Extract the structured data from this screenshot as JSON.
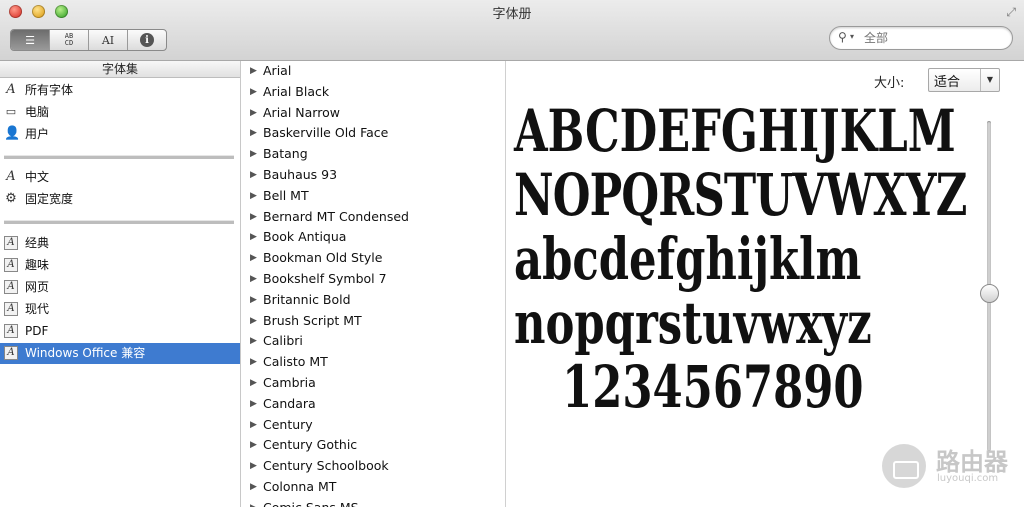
{
  "window": {
    "title": "字体册"
  },
  "toolbar": {
    "view_buttons": [
      {
        "name": "list-view",
        "glyph": "☰"
      },
      {
        "name": "sample-view",
        "glyph": "AB CD"
      },
      {
        "name": "custom-view",
        "glyph": "AI"
      },
      {
        "name": "info-view",
        "glyph": "i"
      }
    ],
    "search": {
      "placeholder": "全部"
    }
  },
  "collections": {
    "header": "字体集",
    "groups": [
      [
        {
          "label": "所有字体",
          "icon": "font-icon"
        },
        {
          "label": "电脑",
          "icon": "computer-icon"
        },
        {
          "label": "用户",
          "icon": "user-icon"
        }
      ],
      [
        {
          "label": "中文",
          "icon": "font-icon"
        },
        {
          "label": "固定宽度",
          "icon": "gear-icon"
        }
      ],
      [
        {
          "label": "经典",
          "icon": "collection-icon"
        },
        {
          "label": "趣味",
          "icon": "collection-icon"
        },
        {
          "label": "网页",
          "icon": "collection-icon"
        },
        {
          "label": "现代",
          "icon": "collection-icon"
        },
        {
          "label": "PDF",
          "icon": "collection-icon"
        },
        {
          "label": "Windows Office 兼容",
          "icon": "collection-icon",
          "selected": true
        }
      ]
    ]
  },
  "fonts": [
    "Arial",
    "Arial Black",
    "Arial Narrow",
    "Baskerville Old Face",
    "Batang",
    "Bauhaus 93",
    "Bell MT",
    "Bernard MT Condensed",
    "Book Antiqua",
    "Bookman Old Style",
    "Bookshelf Symbol 7",
    "Britannic Bold",
    "Brush Script MT",
    "Calibri",
    "Calisto MT",
    "Cambria",
    "Candara",
    "Century",
    "Century Gothic",
    "Century Schoolbook",
    "Colonna MT",
    "Comic Sans MS"
  ],
  "preview": {
    "size_label": "大小:",
    "size_value": "适合",
    "sample_lines": [
      "ABCDEFGHIJKLM",
      "NOPQRSTUVWXYZ",
      "abcdefghijklm",
      "nopqrstuvwxyz",
      "1234567890"
    ],
    "size_slider_fraction": 0.52
  },
  "watermark": {
    "text": "路由器",
    "sub": "luyouqi.com"
  }
}
